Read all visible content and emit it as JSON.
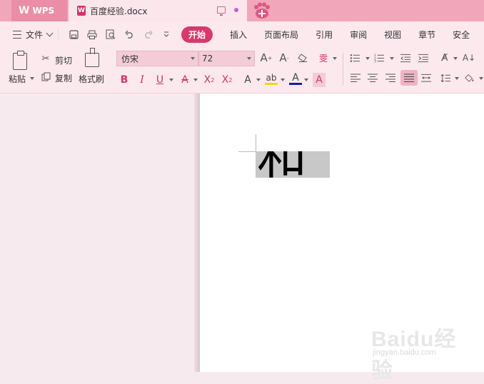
{
  "titlebar": {
    "app_tab_label": "WPS",
    "doc_tab_title": "百度经验.docx",
    "doc_icon_letter": "W"
  },
  "menubar": {
    "file_label": "文件",
    "tabs": [
      "开始",
      "插入",
      "页面布局",
      "引用",
      "审阅",
      "视图",
      "章节",
      "安全"
    ],
    "active_tab": "开始"
  },
  "ribbon": {
    "paste_label": "粘贴",
    "cut_label": "剪切",
    "copy_label": "复制",
    "format_painter_label": "格式刷",
    "font_name": "仿宋",
    "font_size": "72"
  },
  "document": {
    "selected_text": "和"
  },
  "watermark": {
    "main": "Baidu经验",
    "sub": "jingyan.baidu.com"
  },
  "colors": {
    "accent": "#d63a6b",
    "titlebar": "#f1a7b9",
    "ribbon_bg": "#fbe9ee",
    "selection": "#c8c8c8"
  }
}
